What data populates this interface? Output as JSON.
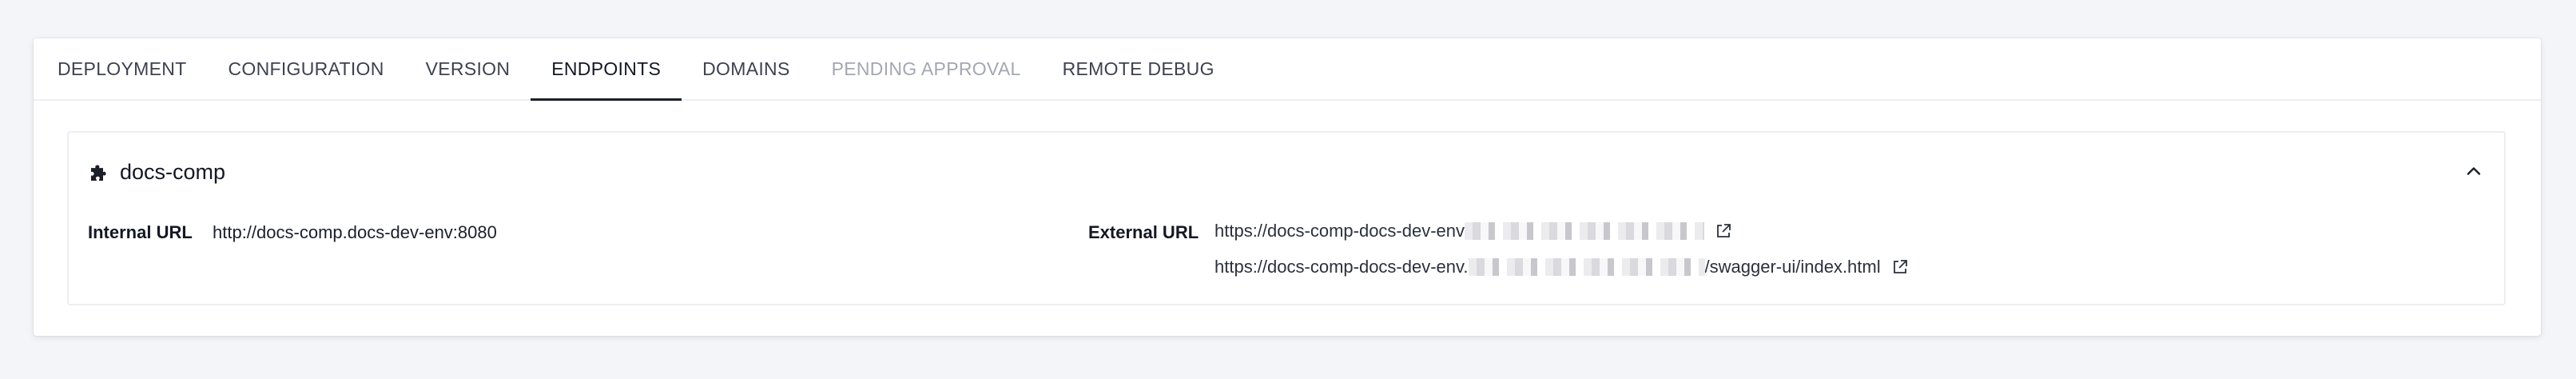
{
  "tabs": [
    {
      "label": "DEPLOYMENT",
      "state": "normal"
    },
    {
      "label": "CONFIGURATION",
      "state": "normal"
    },
    {
      "label": "VERSION",
      "state": "normal"
    },
    {
      "label": "ENDPOINTS",
      "state": "active"
    },
    {
      "label": "DOMAINS",
      "state": "normal"
    },
    {
      "label": "PENDING APPROVAL",
      "state": "disabled"
    },
    {
      "label": "REMOTE DEBUG",
      "state": "normal"
    }
  ],
  "endpoint": {
    "name": "docs-comp",
    "icon": "puzzle-icon",
    "internal_label": "Internal URL",
    "internal_url": "http://docs-comp.docs-dev-env:8080",
    "external_label": "External URL",
    "external_urls": [
      {
        "prefix": "https://docs-comp-docs-dev-env",
        "suffix": ""
      },
      {
        "prefix": "https://docs-comp-docs-dev-env.",
        "suffix": "/swagger-ui/index.html"
      }
    ]
  },
  "colors": {
    "background": "#f4f5f9",
    "active_tab_underline": "#1b1f2a",
    "disabled_tab": "#a3a7b1",
    "border": "#eceef2"
  }
}
